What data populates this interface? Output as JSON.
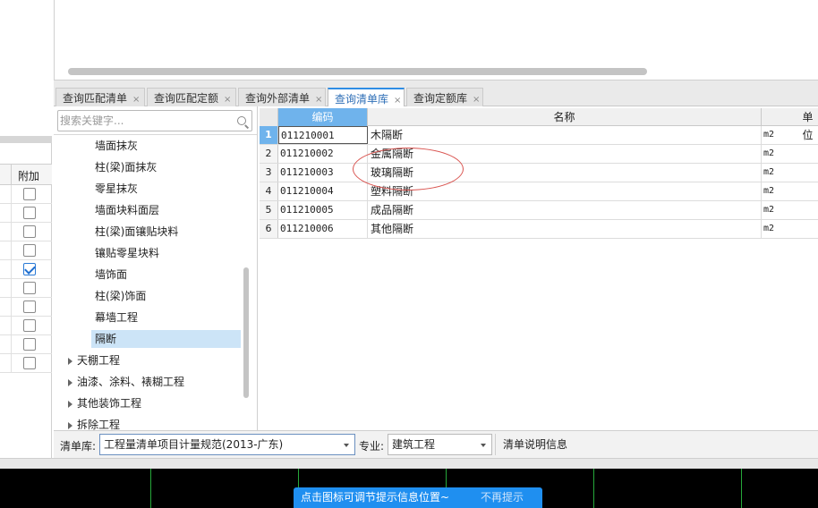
{
  "tabs": [
    {
      "label": "查询匹配清单",
      "active": false
    },
    {
      "label": "查询匹配定额",
      "active": false
    },
    {
      "label": "查询外部清单",
      "active": false
    },
    {
      "label": "查询清单库",
      "active": true
    },
    {
      "label": "查询定额库",
      "active": false
    }
  ],
  "tab_close_glyph": "×",
  "search": {
    "placeholder": "搜索关键字...",
    "value": ""
  },
  "tree": {
    "items": [
      {
        "label": "墙面抹灰",
        "type": "child",
        "selected": false
      },
      {
        "label": "柱(梁)面抹灰",
        "type": "child",
        "selected": false
      },
      {
        "label": "零星抹灰",
        "type": "child",
        "selected": false
      },
      {
        "label": "墙面块料面层",
        "type": "child",
        "selected": false
      },
      {
        "label": "柱(梁)面镶贴块料",
        "type": "child",
        "selected": false
      },
      {
        "label": "镶贴零星块料",
        "type": "child",
        "selected": false
      },
      {
        "label": "墙饰面",
        "type": "child",
        "selected": false
      },
      {
        "label": "柱(梁)饰面",
        "type": "child",
        "selected": false
      },
      {
        "label": "幕墙工程",
        "type": "child",
        "selected": false
      },
      {
        "label": "隔断",
        "type": "child",
        "selected": true
      },
      {
        "label": "天棚工程",
        "type": "parent",
        "selected": false
      },
      {
        "label": "油漆、涂料、裱糊工程",
        "type": "parent",
        "selected": false
      },
      {
        "label": "其他装饰工程",
        "type": "parent",
        "selected": false
      },
      {
        "label": "拆除工程",
        "type": "parent",
        "selected": false
      }
    ]
  },
  "grid": {
    "columns": {
      "code": "编码",
      "name": "名称",
      "unit": "单位"
    },
    "rows": [
      {
        "num": "1",
        "code": "011210001",
        "name": "木隔断",
        "unit": "m2",
        "active": true
      },
      {
        "num": "2",
        "code": "011210002",
        "name": "金属隔断",
        "unit": "m2",
        "active": false
      },
      {
        "num": "3",
        "code": "011210003",
        "name": "玻璃隔断",
        "unit": "m2",
        "active": false
      },
      {
        "num": "4",
        "code": "011210004",
        "name": "塑料隔断",
        "unit": "m2",
        "active": false
      },
      {
        "num": "5",
        "code": "011210005",
        "name": "成品隔断",
        "unit": "m2",
        "active": false
      },
      {
        "num": "6",
        "code": "011210006",
        "name": "其他隔断",
        "unit": "m2",
        "active": false
      }
    ]
  },
  "left_table": {
    "header": "附加",
    "checkboxes": [
      false,
      false,
      false,
      false,
      true,
      false,
      false,
      false,
      false,
      false
    ]
  },
  "bottom": {
    "library_label": "清单库:",
    "library_value": "工程量清单项目计量规范(2013-广东)",
    "specialty_label": "专业:",
    "specialty_value": "建筑工程",
    "info_label": "清单说明信息"
  },
  "toast": {
    "message": "点击图标可调节提示信息位置~",
    "dismiss": "不再提示"
  },
  "colors": {
    "accent": "#2f8de4",
    "header_highlight": "#6fb3ec",
    "tree_selected": "#cce4f7",
    "annotation": "#d9534f",
    "toast_bg": "#1f8ff0"
  }
}
